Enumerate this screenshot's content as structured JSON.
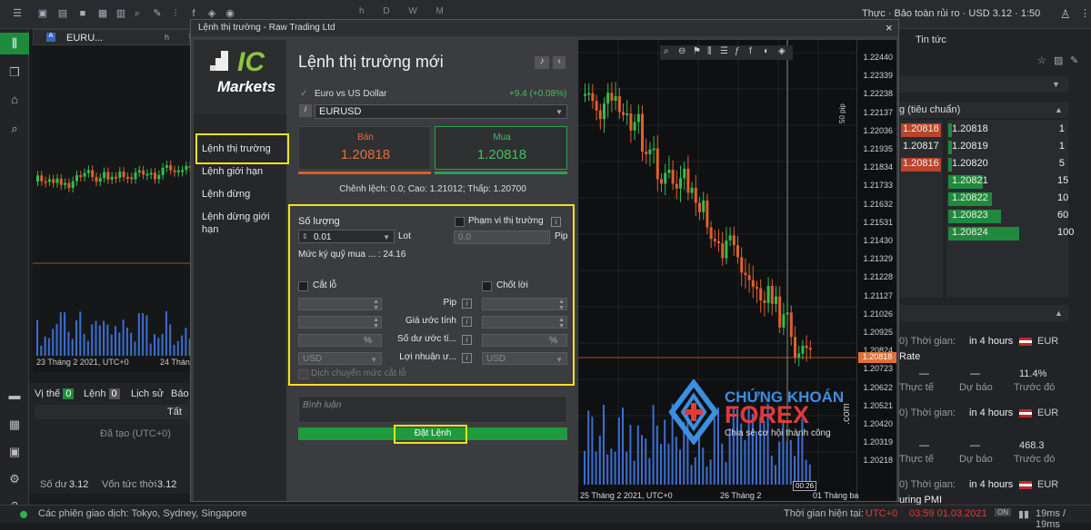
{
  "topbar": {
    "account_status": "Thực · Bảo toàn rủi ro · USD 3.12 · 1:50",
    "letters": "h  D  W  M"
  },
  "tab": {
    "symbol": "EURU...",
    "tf": "h"
  },
  "bg_chart": {
    "date1": "23 Tháng 2 2021, UTC+0",
    "date2": "24 Tháng"
  },
  "bottom": {
    "tabs": [
      {
        "label": "Vị thế",
        "count": "0"
      },
      {
        "label": "Lệnh",
        "count": "0"
      },
      {
        "label": "Lịch sử"
      },
      {
        "label": "Báo"
      }
    ],
    "filter": "Tất",
    "created": "Đã tạo (UTC+0)",
    "balance_label": "Số dư",
    "balance": "3.12",
    "equity_label": "Vốn tức thời",
    "equity": "3.12"
  },
  "status": {
    "sessions": "Các phiên giao dịch: Tokyo, Sydney, Singapore",
    "time_label": "Thời gian hiện tại:",
    "tz": "UTC+0",
    "time": "03:59 01.03.2021",
    "ping": "19ms / 19ms"
  },
  "right": {
    "tab_news": "Tin tức",
    "depth_label": "g (tiêu chuẩn)",
    "bids": [
      {
        "p": "1.20818",
        "highlight": true
      },
      {
        "p": "1.20817",
        "highlight": false
      },
      {
        "p": "1.20816",
        "highlight": true
      }
    ],
    "asks": [
      {
        "p": "1.20818",
        "v": "1"
      },
      {
        "p": "1.20819",
        "v": "1"
      },
      {
        "p": "1.20820",
        "v": "5"
      },
      {
        "p": "1.20821",
        "v": "15"
      },
      {
        "p": "1.20822",
        "v": "10"
      },
      {
        "p": "1.20823",
        "v": "60"
      },
      {
        "p": "1.20824",
        "v": "100"
      }
    ],
    "events": [
      {
        "prefix": "0) Thời gian:",
        "when": "in 4 hours",
        "cur": "EUR",
        "title": "Rate",
        "c1": "—",
        "c2": "—",
        "c3": "11.4%",
        "l1": "Thực tế",
        "l2": "Dự báo",
        "l3": "Trước đó"
      },
      {
        "prefix": "0) Thời gian:",
        "when": "in 4 hours",
        "cur": "EUR",
        "title": "",
        "c1": "—",
        "c2": "—",
        "c3": "468.3",
        "l1": "Thực tế",
        "l2": "Dự báo",
        "l3": "Trước đó"
      },
      {
        "prefix": "0) Thời gian:",
        "when": "in 4 hours",
        "cur": "EUR",
        "title": "uring PMI"
      }
    ]
  },
  "dialog": {
    "title": "Lệnh thị trường - Raw Trading Ltd",
    "logo_ic": "IC",
    "logo_markets": "Markets",
    "menu": [
      "Lệnh thị trường",
      "Lệnh giới hạn",
      "Lệnh dừng",
      "Lệnh dừng giới hạn"
    ],
    "heading": "Lệnh thị trường mới",
    "symbol_name": "Euro vs US Dollar",
    "change": "+9.4 (+0.08%)",
    "symbol": "EURUSD",
    "sell_label": "Bán",
    "sell_price": "1.20818",
    "buy_label": "Mua",
    "buy_price": "1.20818",
    "spread": "Chênh lệch: 0.0; Cao: 1.21012; Thấp: 1.20700",
    "qty_label": "Số lượng",
    "qty": "0.01",
    "lot": "Lot",
    "range_label": "Phạm vi thị trường",
    "range_val": "0.0",
    "pip": "Pip",
    "margin": "Mức ký quỹ mua ... : 24.16",
    "sl": "Cắt lỗ",
    "tp": "Chốt lời",
    "rows": [
      "Pip",
      "Giá ước tính",
      "Số dư ước tí...",
      "Lợi nhuận ư..."
    ],
    "pct": "%",
    "usd": "USD",
    "trailing": "Dịch chuyển mức cắt lỗ",
    "comment": "Bình luận",
    "submit": "Đặt Lệnh"
  },
  "chart": {
    "prices": [
      "1.22440",
      "1.22339",
      "1.22238",
      "1.22137",
      "1.22036",
      "1.21935",
      "1.21834",
      "1.21733",
      "1.21632",
      "1.21531",
      "1.21430",
      "1.21329",
      "1.21228",
      "1.21127",
      "1.21026",
      "1.20925",
      "1.20824",
      "1.20723",
      "1.20622",
      "1.20521",
      "1.20420",
      "1.20319",
      "1.20218"
    ],
    "current": "1.20818",
    "pip50": "50 pip",
    "date1": "25 Tháng 2 2021, UTC+0",
    "date2": "26 Tháng 2",
    "date3": "01 Tháng ba",
    "timer": "00:26"
  },
  "watermark": {
    "line1": "CHỨNG KHOÁN",
    "line2": "FOREX",
    "dotcom": ".com",
    "tag": "Chia sẻ cơ hội thành công"
  }
}
